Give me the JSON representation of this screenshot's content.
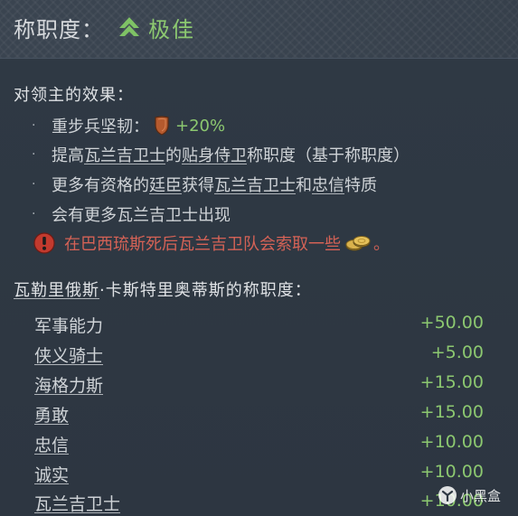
{
  "header": {
    "label": "称职度：",
    "value": "极佳",
    "value_color": "#8cc870",
    "icon": "green-arrow-up-icon"
  },
  "effects": {
    "title": "对领主的效果：",
    "items": [
      {
        "text_prefix": "重步兵坚韧：",
        "icon": "shield-icon",
        "bonus": "+20%"
      },
      {
        "parts": [
          "提高",
          "瓦兰吉卫士",
          "的",
          "贴身侍卫",
          "称职度（基于称职度）"
        ]
      },
      {
        "parts": [
          "更多有资格的",
          "廷臣",
          "获得",
          "瓦兰吉卫士",
          "和",
          "忠信",
          "特质"
        ]
      },
      {
        "text": "会有更多瓦兰吉卫士出现"
      }
    ],
    "warning": {
      "icon": "red-exclamation-icon",
      "text": "在巴西琉斯死后瓦兰吉卫队会索取一些",
      "coin_icon": "gold-coins-icon",
      "suffix": "。",
      "color": "#d46256"
    }
  },
  "breakdown": {
    "title_name": "瓦勒里俄斯",
    "title_rest": "·卡斯特里奥蒂斯的称职度：",
    "rows": [
      {
        "name": "军事能力",
        "value": "+50.00"
      },
      {
        "name": "侠义骑士",
        "value": "+5.00"
      },
      {
        "name": "海格力斯",
        "value": "+15.00"
      },
      {
        "name": "勇敢",
        "value": "+15.00"
      },
      {
        "name": "忠信",
        "value": "+10.00"
      },
      {
        "name": "诚实",
        "value": "+10.00"
      },
      {
        "name": "瓦兰吉卫士",
        "value": "+10.00"
      }
    ]
  },
  "watermark": {
    "text": "小黑盒"
  }
}
